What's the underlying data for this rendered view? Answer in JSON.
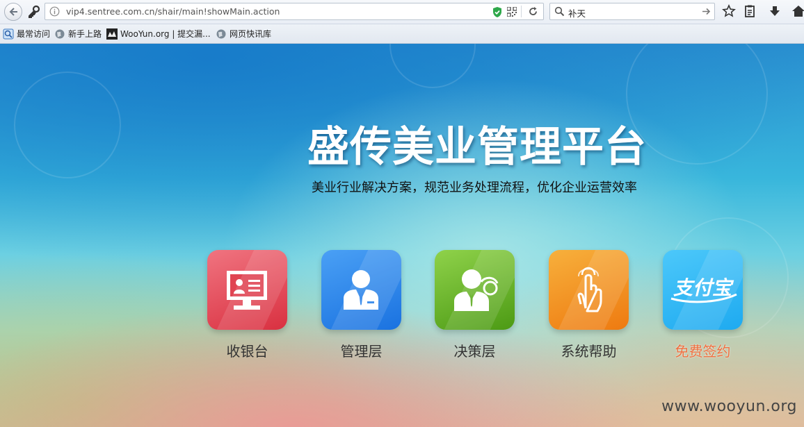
{
  "browser": {
    "url": "vip4.sentree.com.cn/shair/main!showMain.action",
    "search_value": "补天",
    "bookmarks": [
      {
        "label": "最常访问",
        "icon": "most-visited-icon"
      },
      {
        "label": "新手上路",
        "icon": "globe-icon"
      },
      {
        "label": "WooYun.org | 提交漏...",
        "icon": "wooyun-icon"
      },
      {
        "label": "网页快讯库",
        "icon": "globe-icon"
      }
    ],
    "toolbar_icons": [
      "star-icon",
      "reading-list-icon",
      "download-icon",
      "home-icon"
    ]
  },
  "hero": {
    "title": "盛传美业管理平台",
    "subtitle": "美业行业解决方案，规范业务处理流程，优化企业运营效率"
  },
  "tiles": [
    {
      "label": "收银台",
      "icon": "cashier-terminal-icon",
      "color": "#e0404c"
    },
    {
      "label": "管理层",
      "icon": "manager-person-icon",
      "color": "#2b86ee"
    },
    {
      "label": "决策层",
      "icon": "decision-support-icon",
      "color": "#5aaa1c"
    },
    {
      "label": "系统帮助",
      "icon": "pointing-hand-icon",
      "color": "#f08a18"
    },
    {
      "label": "免费签约",
      "icon": "alipay-logo-icon",
      "logo_text": "支付宝",
      "color": "#2bb7f4",
      "label_color": "#f07040"
    }
  ],
  "watermark": "www.wooyun.org"
}
